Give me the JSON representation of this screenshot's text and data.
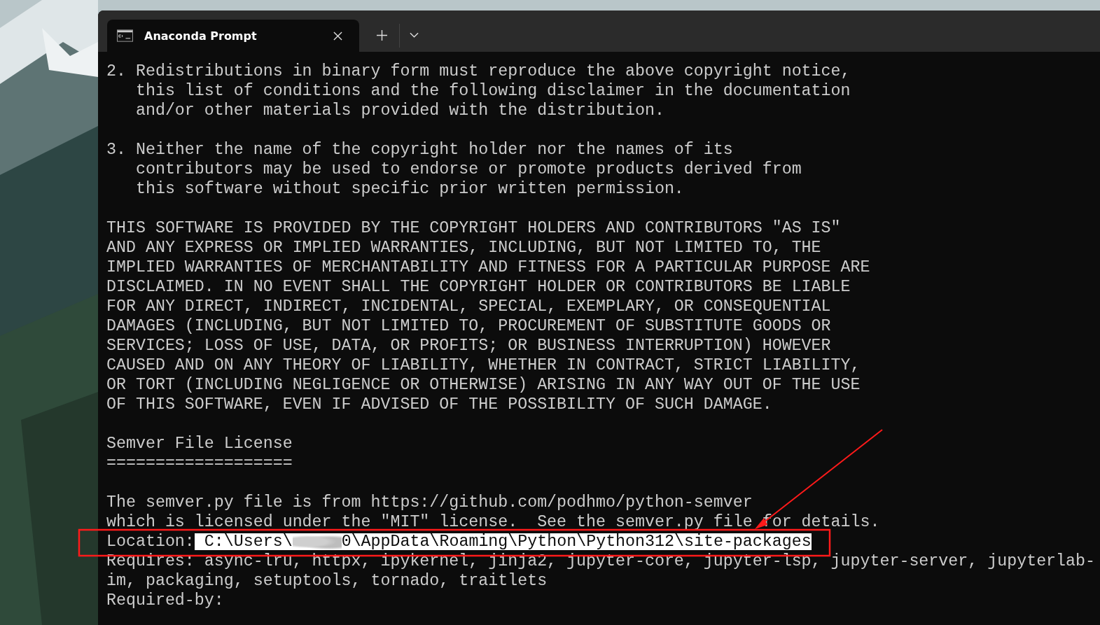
{
  "window": {
    "tab": {
      "title": "Anaconda Prompt",
      "selected": true
    }
  },
  "terminal": {
    "blocks": [
      [
        "2. Redistributions in binary form must reproduce the above copyright notice,",
        "   this list of conditions and the following disclaimer in the documentation",
        "   and/or other materials provided with the distribution."
      ],
      [
        "3. Neither the name of the copyright holder nor the names of its",
        "   contributors may be used to endorse or promote products derived from",
        "   this software without specific prior written permission."
      ],
      [
        "THIS SOFTWARE IS PROVIDED BY THE COPYRIGHT HOLDERS AND CONTRIBUTORS \"AS IS\"",
        "AND ANY EXPRESS OR IMPLIED WARRANTIES, INCLUDING, BUT NOT LIMITED TO, THE",
        "IMPLIED WARRANTIES OF MERCHANTABILITY AND FITNESS FOR A PARTICULAR PURPOSE ARE",
        "DISCLAIMED. IN NO EVENT SHALL THE COPYRIGHT HOLDER OR CONTRIBUTORS BE LIABLE",
        "FOR ANY DIRECT, INDIRECT, INCIDENTAL, SPECIAL, EXEMPLARY, OR CONSEQUENTIAL",
        "DAMAGES (INCLUDING, BUT NOT LIMITED TO, PROCUREMENT OF SUBSTITUTE GOODS OR",
        "SERVICES; LOSS OF USE, DATA, OR PROFITS; OR BUSINESS INTERRUPTION) HOWEVER",
        "CAUSED AND ON ANY THEORY OF LIABILITY, WHETHER IN CONTRACT, STRICT LIABILITY,",
        "OR TORT (INCLUDING NEGLIGENCE OR OTHERWISE) ARISING IN ANY WAY OUT OF THE USE",
        "OF THIS SOFTWARE, EVEN IF ADVISED OF THE POSSIBILITY OF SUCH DAMAGE."
      ],
      [
        "Semver File License",
        "==================="
      ],
      [
        "The semver.py file is from https://github.com/podhmo/python-semver",
        "which is licensed under the \"MIT\" license.  See the semver.py file for details."
      ]
    ],
    "location": {
      "label": "Location:",
      "path_start": "C:\\Users\\",
      "path_end": "0\\AppData\\Roaming\\Python\\Python312\\site-packages",
      "selected": true
    },
    "after_lines": [
      "Requires: async-lru, httpx, ipykernel, jinja2, jupyter-core, jupyter-lsp, jupyter-server, jupyterlab-",
      "im, packaging, setuptools, tornado, traitlets",
      "Required-by:"
    ]
  }
}
